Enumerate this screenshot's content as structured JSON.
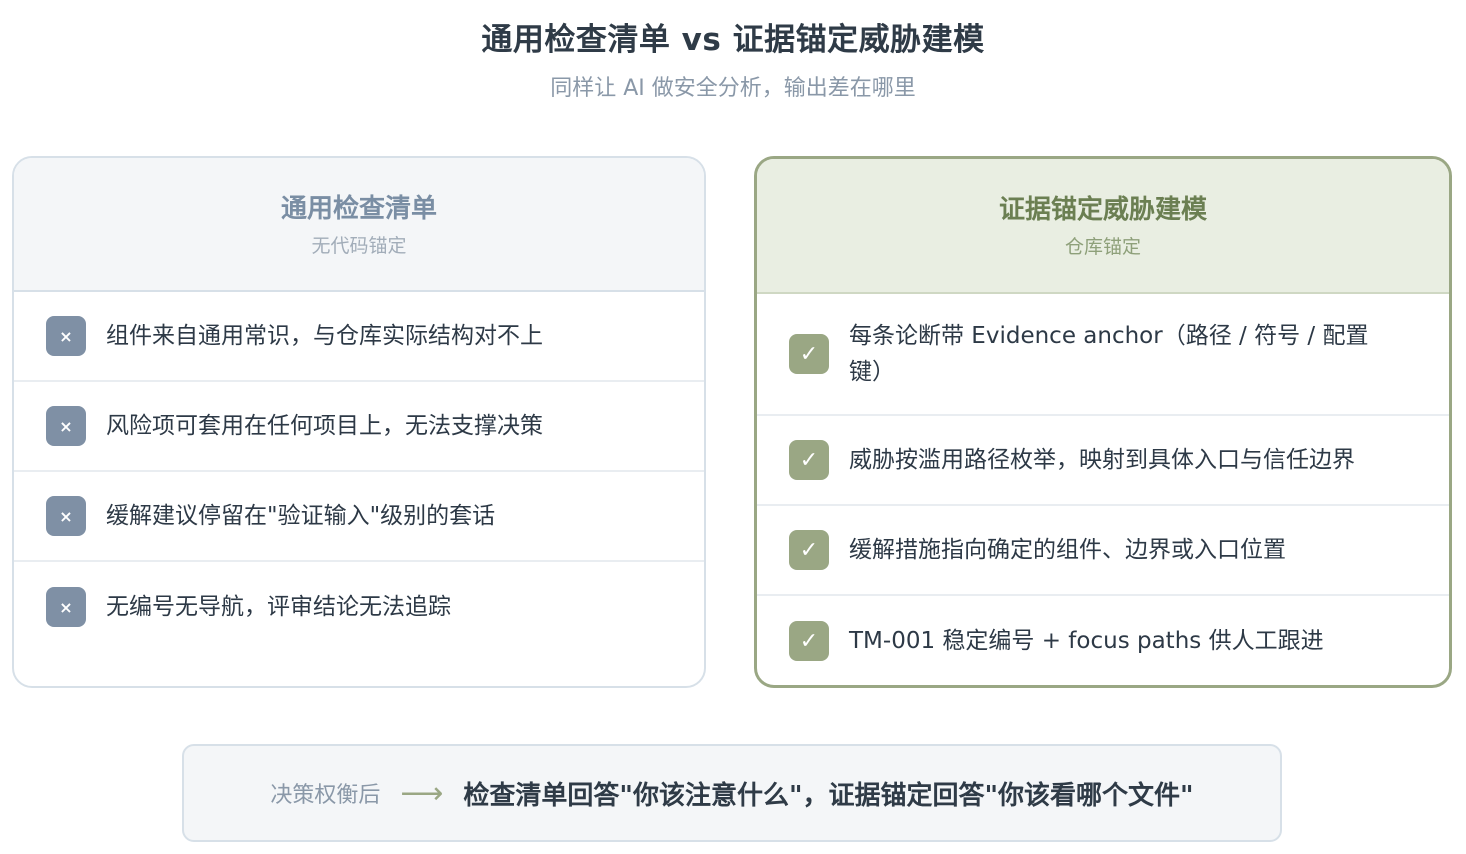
{
  "header": {
    "title": "通用检查清单 vs 证据锚定威胁建模",
    "subtitle": "同样让 AI 做安全分析，输出差在哪里"
  },
  "left_panel": {
    "title": "通用检查清单",
    "subtitle": "无代码锚定",
    "icon": "cross-icon",
    "items": [
      {
        "mark": "×",
        "text": "组件来自通用常识，与仓库实际结构对不上"
      },
      {
        "mark": "×",
        "text": "风险项可套用在任何项目上，无法支撑决策"
      },
      {
        "mark": "×",
        "text": "缓解建议停留在\"验证输入\"级别的套话"
      },
      {
        "mark": "×",
        "text": "无编号无导航，评审结论无法追踪"
      }
    ]
  },
  "right_panel": {
    "title": "证据锚定威胁建模",
    "subtitle": "仓库锚定",
    "icon": "check-icon",
    "items": [
      {
        "mark": "✓",
        "text": "每条论断带 Evidence anchor（路径 / 符号 / 配置键）"
      },
      {
        "mark": "✓",
        "text": "威胁按滥用路径枚举，映射到具体入口与信任边界"
      },
      {
        "mark": "✓",
        "text": "缓解措施指向确定的组件、边界或入口位置"
      },
      {
        "mark": "✓",
        "text": "TM-001 稳定编号 + focus paths 供人工跟进"
      }
    ]
  },
  "decision": {
    "label": "决策权衡后",
    "arrow": "⟶",
    "text": "检查清单回答\"你该注意什么\"，证据锚定回答\"你该看哪个文件\""
  },
  "colors": {
    "left_accent": "#7f90a5",
    "right_accent": "#9aa784",
    "text_dark": "#2f3b47"
  }
}
